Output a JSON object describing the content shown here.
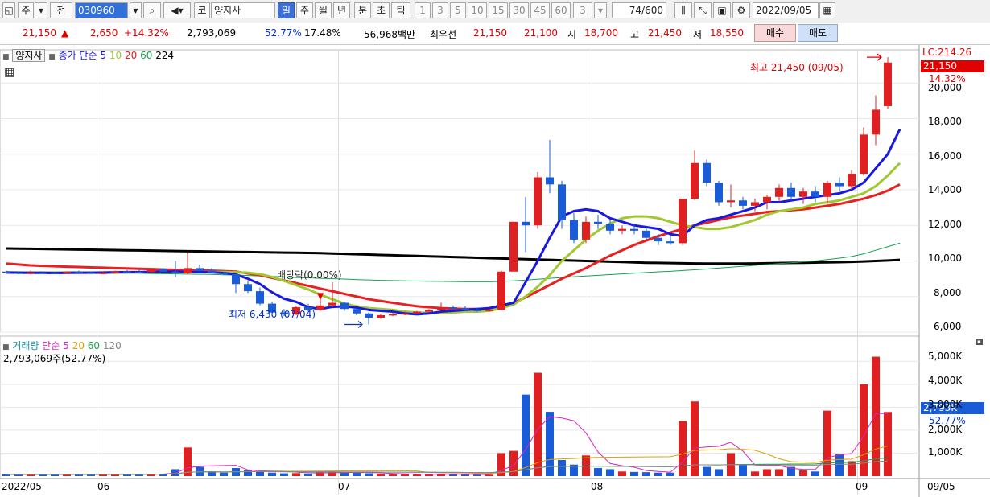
{
  "toolbar": {
    "market": "주",
    "prev_label": "전",
    "code": "030960",
    "market_badge": "코",
    "stock_name": "양지사",
    "periods": [
      "일",
      "주",
      "월",
      "년",
      "분",
      "초",
      "틱"
    ],
    "active_period": "일",
    "intervals": [
      "1",
      "3",
      "5",
      "10",
      "15",
      "30",
      "45",
      "60"
    ],
    "interval_value": "3",
    "count": "74",
    "count_max": "/600",
    "date": "2022/09/05"
  },
  "quote": {
    "price": "21,150",
    "change": "2,650",
    "change_pct": "+14.32%",
    "volume": "2,793,069",
    "vol_ratio": "52.77%",
    "turnover": "17.48%",
    "amount": "56,968백만",
    "best_label": "최우선",
    "ask": "21,150",
    "bid": "21,100",
    "open_label": "시",
    "open": "18,700",
    "high_label": "고",
    "high": "21,450",
    "low_label": "저",
    "low": "18,550",
    "buy_button": "매수",
    "sell_button": "매도"
  },
  "price_panel": {
    "name_tag": "양지사",
    "indicator_label": "종가 단순",
    "ma_labels": [
      "5",
      "10",
      "20",
      "60",
      "224"
    ],
    "ma_colors": [
      "#1818e0",
      "#a0c830",
      "#e82020",
      "#18a050",
      "#000000"
    ],
    "lc_label": "LC:214.26",
    "current_price": "21,150",
    "current_pct": "14.32%",
    "high_annotation": "최고 21,450 (09/05)",
    "low_annotation": "최저 6,430 (07/04)",
    "dividend_annotation": "배당락(0.00%)",
    "y_ticks": [
      "20,000",
      "18,000",
      "16,000",
      "14,000",
      "12,000",
      "10,000",
      "8,000",
      "6,000"
    ]
  },
  "volume_panel": {
    "title": "거래량",
    "indicator_label": "단순",
    "ma_labels": [
      "5",
      "20",
      "60",
      "120"
    ],
    "ma_colors": [
      "#e020c0",
      "#e0a000",
      "#18a050",
      "#888888"
    ],
    "value_label": "2,793,069주(52.77%)",
    "current_volume": "2,793K",
    "current_pct": "52.77%",
    "y_ticks": [
      "5,000K",
      "4,000K",
      "3,000K",
      "2,000K",
      "1,000K"
    ]
  },
  "x_axis": {
    "labels": [
      "2022/05",
      "06",
      "07",
      "08",
      "09"
    ],
    "end_label": "09/05"
  },
  "chart_data": {
    "type": "candlestick",
    "y_range": [
      6000,
      21500
    ],
    "volume_range": [
      0,
      5500
    ],
    "month_start_index": {
      "06": 8,
      "07": 28,
      "08": 49,
      "09": 71
    },
    "candles": [
      {
        "o": 9400,
        "h": 9450,
        "l": 9300,
        "c": 9350,
        "v": 80
      },
      {
        "o": 9350,
        "h": 9400,
        "l": 9250,
        "c": 9300,
        "v": 70
      },
      {
        "o": 9300,
        "h": 9450,
        "l": 9250,
        "c": 9350,
        "v": 90
      },
      {
        "o": 9350,
        "h": 9400,
        "l": 9300,
        "c": 9330,
        "v": 60
      },
      {
        "o": 9330,
        "h": 9400,
        "l": 9280,
        "c": 9300,
        "v": 70
      },
      {
        "o": 9300,
        "h": 9420,
        "l": 9280,
        "c": 9380,
        "v": 100
      },
      {
        "o": 9380,
        "h": 9450,
        "l": 9300,
        "c": 9350,
        "v": 80
      },
      {
        "o": 9350,
        "h": 9400,
        "l": 9280,
        "c": 9300,
        "v": 70
      },
      {
        "o": 9300,
        "h": 9400,
        "l": 9250,
        "c": 9330,
        "v": 80
      },
      {
        "o": 9330,
        "h": 9450,
        "l": 9300,
        "c": 9420,
        "v": 90
      },
      {
        "o": 9420,
        "h": 9500,
        "l": 9350,
        "c": 9400,
        "v": 80
      },
      {
        "o": 9400,
        "h": 9500,
        "l": 9350,
        "c": 9380,
        "v": 90
      },
      {
        "o": 9380,
        "h": 9600,
        "l": 9350,
        "c": 9550,
        "v": 100
      },
      {
        "o": 9550,
        "h": 9600,
        "l": 9380,
        "c": 9400,
        "v": 80
      },
      {
        "o": 9400,
        "h": 10000,
        "l": 9100,
        "c": 9300,
        "v": 300
      },
      {
        "o": 9300,
        "h": 10500,
        "l": 9250,
        "c": 9600,
        "v": 1250
      },
      {
        "o": 9600,
        "h": 9800,
        "l": 9400,
        "c": 9450,
        "v": 400
      },
      {
        "o": 9450,
        "h": 9600,
        "l": 9300,
        "c": 9350,
        "v": 200
      },
      {
        "o": 9350,
        "h": 9400,
        "l": 9200,
        "c": 9250,
        "v": 150
      },
      {
        "o": 9250,
        "h": 9300,
        "l": 8200,
        "c": 8700,
        "v": 350
      },
      {
        "o": 8700,
        "h": 8900,
        "l": 8200,
        "c": 8300,
        "v": 250
      },
      {
        "o": 8300,
        "h": 8500,
        "l": 7500,
        "c": 7600,
        "v": 200
      },
      {
        "o": 7600,
        "h": 7700,
        "l": 6900,
        "c": 7100,
        "v": 150
      },
      {
        "o": 7100,
        "h": 7300,
        "l": 6900,
        "c": 7000,
        "v": 120
      },
      {
        "o": 7000,
        "h": 7500,
        "l": 6950,
        "c": 7400,
        "v": 130
      },
      {
        "o": 7400,
        "h": 7600,
        "l": 7150,
        "c": 7250,
        "v": 100
      },
      {
        "o": 7250,
        "h": 8000,
        "l": 7200,
        "c": 7500,
        "v": 180
      },
      {
        "o": 7500,
        "h": 8800,
        "l": 7400,
        "c": 7650,
        "v": 200
      },
      {
        "o": 7650,
        "h": 7700,
        "l": 7200,
        "c": 7300,
        "v": 150
      },
      {
        "o": 7300,
        "h": 7350,
        "l": 6950,
        "c": 7050,
        "v": 140
      },
      {
        "o": 7050,
        "h": 7100,
        "l": 6430,
        "c": 6800,
        "v": 120
      },
      {
        "o": 6800,
        "h": 7000,
        "l": 6750,
        "c": 6950,
        "v": 90
      },
      {
        "o": 6950,
        "h": 7100,
        "l": 6900,
        "c": 7000,
        "v": 80
      },
      {
        "o": 7000,
        "h": 7150,
        "l": 6950,
        "c": 7050,
        "v": 70
      },
      {
        "o": 7050,
        "h": 7200,
        "l": 7000,
        "c": 7150,
        "v": 70
      },
      {
        "o": 7150,
        "h": 7300,
        "l": 7100,
        "c": 7250,
        "v": 80
      },
      {
        "o": 7250,
        "h": 7650,
        "l": 7200,
        "c": 7400,
        "v": 90
      },
      {
        "o": 7400,
        "h": 7500,
        "l": 7300,
        "c": 7350,
        "v": 80
      },
      {
        "o": 7350,
        "h": 7450,
        "l": 7200,
        "c": 7250,
        "v": 70
      },
      {
        "o": 7250,
        "h": 7350,
        "l": 7150,
        "c": 7200,
        "v": 60
      },
      {
        "o": 7200,
        "h": 7300,
        "l": 7150,
        "c": 7250,
        "v": 60
      },
      {
        "o": 7250,
        "h": 9450,
        "l": 7250,
        "c": 9400,
        "v": 1000
      },
      {
        "o": 9400,
        "h": 12200,
        "l": 9400,
        "c": 12200,
        "v": 1100
      },
      {
        "o": 12200,
        "h": 13600,
        "l": 10500,
        "c": 12000,
        "v": 3550
      },
      {
        "o": 12000,
        "h": 15000,
        "l": 11800,
        "c": 14700,
        "v": 4500
      },
      {
        "o": 14700,
        "h": 16800,
        "l": 13800,
        "c": 14300,
        "v": 2800
      },
      {
        "o": 14300,
        "h": 14500,
        "l": 11800,
        "c": 12300,
        "v": 700
      },
      {
        "o": 12300,
        "h": 12700,
        "l": 11000,
        "c": 11200,
        "v": 500
      },
      {
        "o": 11200,
        "h": 12500,
        "l": 11000,
        "c": 12200,
        "v": 900
      },
      {
        "o": 12200,
        "h": 12600,
        "l": 11800,
        "c": 12100,
        "v": 350
      },
      {
        "o": 12100,
        "h": 12300,
        "l": 11500,
        "c": 11700,
        "v": 300
      },
      {
        "o": 11700,
        "h": 12000,
        "l": 11500,
        "c": 11800,
        "v": 200
      },
      {
        "o": 11800,
        "h": 12100,
        "l": 11500,
        "c": 11700,
        "v": 180
      },
      {
        "o": 11700,
        "h": 11900,
        "l": 11200,
        "c": 11300,
        "v": 170
      },
      {
        "o": 11300,
        "h": 11500,
        "l": 10900,
        "c": 11100,
        "v": 150
      },
      {
        "o": 11100,
        "h": 11400,
        "l": 10900,
        "c": 11000,
        "v": 150
      },
      {
        "o": 11000,
        "h": 13500,
        "l": 10900,
        "c": 13500,
        "v": 2400
      },
      {
        "o": 13500,
        "h": 16200,
        "l": 13400,
        "c": 15500,
        "v": 3250
      },
      {
        "o": 15500,
        "h": 15700,
        "l": 14200,
        "c": 14400,
        "v": 400
      },
      {
        "o": 14400,
        "h": 14500,
        "l": 13100,
        "c": 13300,
        "v": 300
      },
      {
        "o": 13300,
        "h": 14300,
        "l": 13000,
        "c": 13400,
        "v": 1000
      },
      {
        "o": 13400,
        "h": 13600,
        "l": 12900,
        "c": 13100,
        "v": 500
      },
      {
        "o": 13100,
        "h": 13500,
        "l": 12800,
        "c": 13300,
        "v": 200
      },
      {
        "o": 13300,
        "h": 13700,
        "l": 12900,
        "c": 13600,
        "v": 300
      },
      {
        "o": 13600,
        "h": 14300,
        "l": 13300,
        "c": 14100,
        "v": 300
      },
      {
        "o": 14100,
        "h": 14400,
        "l": 13400,
        "c": 13600,
        "v": 400
      },
      {
        "o": 13600,
        "h": 14100,
        "l": 13200,
        "c": 13900,
        "v": 250
      },
      {
        "o": 13900,
        "h": 14200,
        "l": 13300,
        "c": 13600,
        "v": 200
      },
      {
        "o": 13600,
        "h": 14500,
        "l": 13200,
        "c": 14400,
        "v": 2850
      },
      {
        "o": 14400,
        "h": 14700,
        "l": 13900,
        "c": 14200,
        "v": 950
      },
      {
        "o": 14200,
        "h": 15100,
        "l": 14000,
        "c": 14900,
        "v": 650
      },
      {
        "o": 14900,
        "h": 17500,
        "l": 14800,
        "c": 17100,
        "v": 4000
      },
      {
        "o": 17100,
        "h": 19300,
        "l": 16500,
        "c": 18500,
        "v": 5200
      },
      {
        "o": 18700,
        "h": 21450,
        "l": 18550,
        "c": 21150,
        "v": 2793
      }
    ],
    "ma_price": {
      "5": [
        9350,
        9340,
        9330,
        9330,
        9320,
        9330,
        9340,
        9340,
        9350,
        9360,
        9370,
        9370,
        9390,
        9400,
        9400,
        9380,
        9380,
        9360,
        9320,
        9240,
        9000,
        8700,
        8240,
        7880,
        7700,
        7400,
        7300,
        7420,
        7450,
        7380,
        7250,
        7200,
        7150,
        7050,
        7000,
        7050,
        7150,
        7200,
        7250,
        7300,
        7350,
        7500,
        7650,
        8800,
        10000,
        11300,
        12500,
        12800,
        12900,
        12800,
        12400,
        12200,
        12000,
        11900,
        11800,
        11500,
        11400,
        12000,
        12300,
        12400,
        12600,
        12800,
        13000,
        13300,
        13300,
        13400,
        13500,
        13600,
        13700,
        13800,
        14000,
        14400,
        15200,
        16000,
        17400
      ],
      "10": [
        9350,
        9350,
        9350,
        9350,
        9350,
        9350,
        9350,
        9340,
        9340,
        9340,
        9340,
        9350,
        9360,
        9370,
        9380,
        9380,
        9380,
        9380,
        9380,
        9360,
        9340,
        9260,
        9100,
        8880,
        8640,
        8400,
        8100,
        7850,
        7600,
        7450,
        7350,
        7300,
        7250,
        7150,
        7100,
        7080,
        7060,
        7100,
        7150,
        7150,
        7200,
        7350,
        7550,
        8000,
        8550,
        9200,
        10000,
        10600,
        11200,
        11700,
        12100,
        12400,
        12500,
        12500,
        12400,
        12200,
        12000,
        11900,
        11800,
        11800,
        11900,
        12100,
        12300,
        12600,
        12800,
        12900,
        13000,
        13200,
        13300,
        13400,
        13600,
        13800,
        14200,
        14800,
        15500
      ],
      "20": [
        9850,
        9800,
        9750,
        9720,
        9700,
        9680,
        9660,
        9640,
        9620,
        9600,
        9580,
        9560,
        9540,
        9520,
        9500,
        9480,
        9470,
        9450,
        9430,
        9400,
        9300,
        9200,
        9050,
        8900,
        8750,
        8600,
        8450,
        8300,
        8150,
        8000,
        7850,
        7750,
        7650,
        7550,
        7450,
        7400,
        7350,
        7320,
        7300,
        7300,
        7320,
        7450,
        7650,
        7950,
        8300,
        8650,
        9000,
        9300,
        9600,
        9950,
        10300,
        10600,
        10900,
        11150,
        11400,
        11600,
        11800,
        12000,
        12150,
        12300,
        12450,
        12550,
        12650,
        12750,
        12800,
        12850,
        12900,
        13000,
        13100,
        13200,
        13350,
        13500,
        13700,
        13950,
        14300
      ],
      "60": [
        9400,
        9390,
        9380,
        9370,
        9360,
        9350,
        9340,
        9330,
        9330,
        9320,
        9310,
        9300,
        9290,
        9280,
        9270,
        9260,
        9250,
        9240,
        9220,
        9200,
        9180,
        9160,
        9130,
        9100,
        9070,
        9050,
        9020,
        9000,
        8980,
        8950,
        8930,
        8910,
        8900,
        8880,
        8870,
        8860,
        8850,
        8840,
        8830,
        8830,
        8830,
        8850,
        8880,
        8920,
        8970,
        9020,
        9070,
        9110,
        9150,
        9190,
        9230,
        9270,
        9310,
        9350,
        9390,
        9420,
        9460,
        9500,
        9550,
        9600,
        9650,
        9700,
        9750,
        9800,
        9850,
        9900,
        9950,
        10000,
        10080,
        10160,
        10250,
        10400,
        10600,
        10800,
        11000
      ],
      "224": [
        10700,
        10690,
        10680,
        10670,
        10660,
        10650,
        10640,
        10630,
        10620,
        10610,
        10600,
        10590,
        10580,
        10570,
        10560,
        10550,
        10540,
        10530,
        10520,
        10510,
        10500,
        10490,
        10480,
        10470,
        10460,
        10450,
        10440,
        10420,
        10400,
        10380,
        10360,
        10340,
        10320,
        10300,
        10280,
        10260,
        10240,
        10220,
        10200,
        10180,
        10160,
        10140,
        10120,
        10100,
        10080,
        10060,
        10040,
        10020,
        10000,
        9980,
        9960,
        9940,
        9920,
        9900,
        9890,
        9880,
        9870,
        9860,
        9850,
        9850,
        9850,
        9850,
        9860,
        9870,
        9880,
        9890,
        9900,
        9910,
        9920,
        9930,
        9950,
        9970,
        10000,
        10030,
        10060
      ]
    }
  }
}
